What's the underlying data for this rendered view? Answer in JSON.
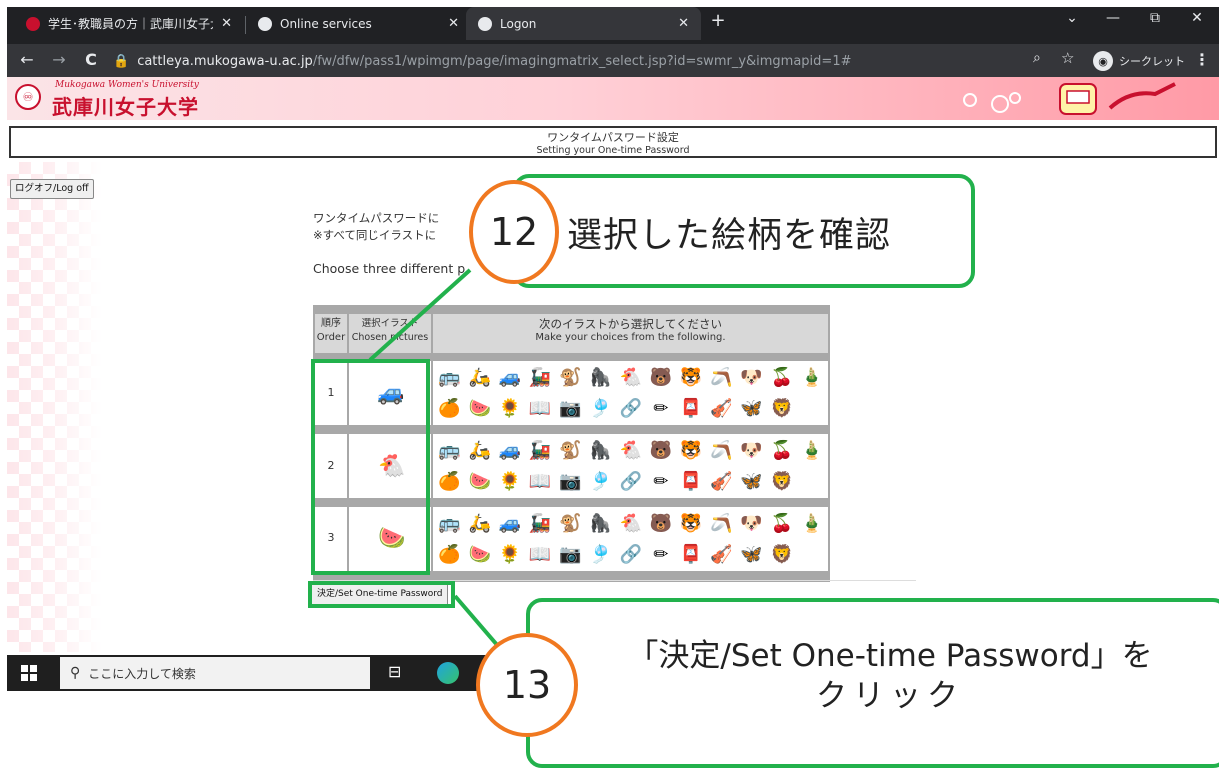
{
  "browser": {
    "tabs": [
      {
        "title": "学生･教職員の方｜武庫川女子大",
        "close": "✕"
      },
      {
        "title": "Online services",
        "close": "✕"
      },
      {
        "title": "Logon",
        "close": "✕"
      }
    ],
    "new_tab": "+",
    "window_controls": {
      "menu": "⌄",
      "minimize": "—",
      "restore": "⧉",
      "close": "✕"
    },
    "nav": {
      "back": "←",
      "forward": "→",
      "reload": "C"
    },
    "url_host": "cattleya.mukogawa-u.ac.jp",
    "url_path": "/fw/dfw/pass1/wpimgm/page/imagingmatrix_select.jsp?id=swmr_y&imgmapid=1#",
    "incognito_label": "シークレット",
    "menu_icon": "⋮"
  },
  "site": {
    "logo_en": "Mukogawa Women's University",
    "logo_jp": "武庫川女子大学"
  },
  "page_title": {
    "jp": "ワンタイムパスワード設定",
    "en": "Setting your One-time Password"
  },
  "logoff_label": "ログオフ/Log off",
  "instructions": {
    "line1": "ワンタイムパスワードに",
    "line2": "※すべて同じイラストに",
    "line3": "Choose three different p"
  },
  "table": {
    "headers": {
      "order_jp": "順序",
      "order_en": "Order",
      "chosen_jp": "選択イラスト",
      "chosen_en": "Chosen pictures",
      "choices_jp": "次のイラストから選択してください",
      "choices_en": "Make your choices from the following."
    },
    "row_numbers": [
      "1",
      "2",
      "3"
    ],
    "chosen_pictures": [
      "🚙",
      "🐔",
      "🍉"
    ],
    "picture_icons": [
      "🚌",
      "🛵",
      "🚙",
      "🚂",
      "🐒",
      "🦍",
      "🐔",
      "🐻",
      "🐯",
      "✂",
      "🐶",
      "🍒",
      "🎍",
      "🍊",
      "🍉",
      "🌻",
      "📖",
      "📷",
      "🎐",
      "✏",
      "✏",
      "📮",
      "🎻",
      "🦋",
      "🦁"
    ],
    "picture_row1": [
      "🚌",
      "🛵",
      "🚙",
      "🚂",
      "🐒",
      "🦍",
      "🐔",
      "🐻",
      "🐯",
      "🪃",
      "🐶",
      "🍒",
      "🎍"
    ],
    "picture_row2": [
      "🍊",
      "🍉",
      "🌻",
      "📖",
      "📷",
      "🎐",
      "🔗",
      "✏",
      "📮",
      "🎻",
      "🦋",
      "🦁",
      ""
    ]
  },
  "set_button_label": "決定/Set One-time Password",
  "taskbar": {
    "start_icon": "windows-logo",
    "search_placeholder": "ここに入力して検索"
  },
  "annotations": {
    "step12_number": "12",
    "step12_text": "選択した絵柄を確認",
    "step13_number": "13",
    "step13_line1": "「決定/Set One-time Password」を",
    "step13_line2": "クリック"
  },
  "colors": {
    "callout_green": "#22b14c",
    "badge_orange": "#f07820",
    "brand_red": "#c8102e"
  }
}
